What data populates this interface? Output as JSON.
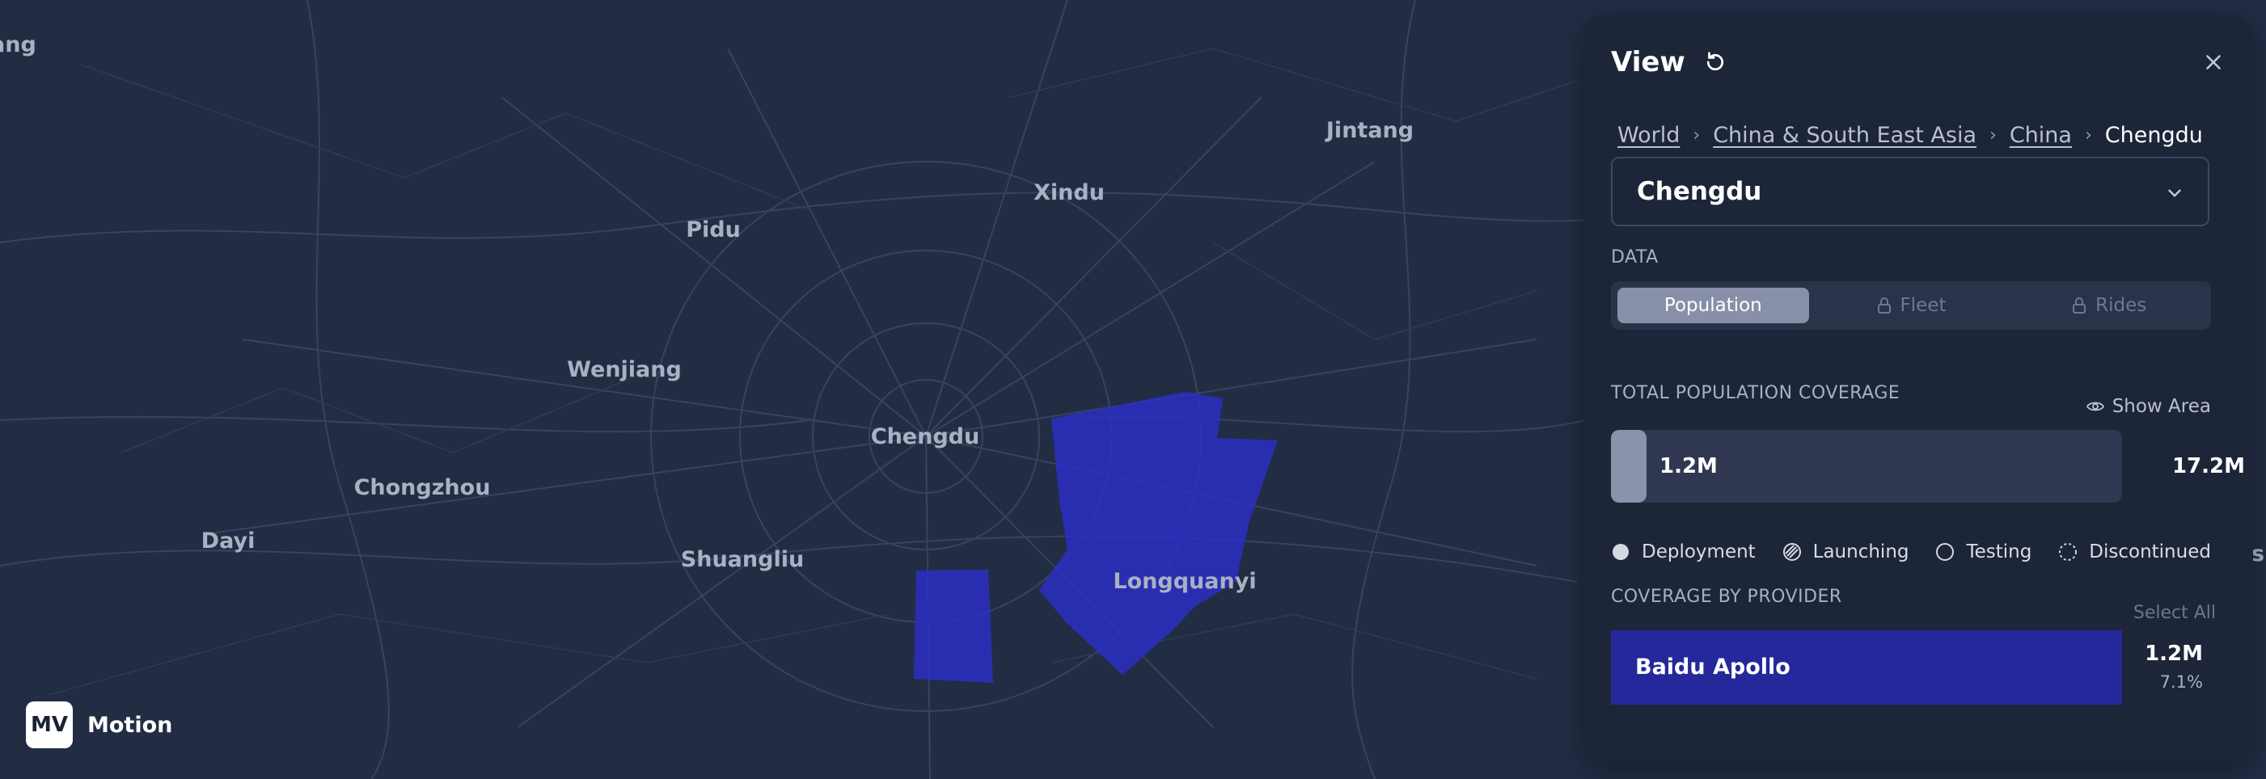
{
  "map": {
    "cities": [
      {
        "name": "ang",
        "id": "ang"
      },
      {
        "name": "Jintang",
        "id": "jintang"
      },
      {
        "name": "Xindu",
        "id": "xindu"
      },
      {
        "name": "Pidu",
        "id": "pidu"
      },
      {
        "name": "Wenjiang",
        "id": "wenjiang"
      },
      {
        "name": "Chengdu",
        "id": "chengdu"
      },
      {
        "name": "Chongzhou",
        "id": "chongzhou"
      },
      {
        "name": "Dayi",
        "id": "dayi"
      },
      {
        "name": "Shuangliu",
        "id": "shuangliu"
      },
      {
        "name": "Longquanyi",
        "id": "longquanyi"
      },
      {
        "name": "sh",
        "id": "sh"
      }
    ],
    "coverage_color": "#2a2fc4"
  },
  "brand": {
    "badge": "MV",
    "name": "Motion"
  },
  "panel": {
    "title": "View",
    "breadcrumb": {
      "world": "World",
      "region": "China & South East Asia",
      "country": "China",
      "city": "Chengdu"
    },
    "location_select": "Chengdu",
    "data_label": "DATA",
    "tabs": {
      "population": "Population",
      "fleet": "Fleet",
      "rides": "Rides"
    },
    "coverage": {
      "label": "TOTAL POPULATION COVERAGE",
      "show_area": "Show Area",
      "value": "1.2M",
      "total": "17.2M",
      "fraction": 0.07
    },
    "legend": {
      "deployment": "Deployment",
      "launching": "Launching",
      "testing": "Testing",
      "discontinued": "Discontinued"
    },
    "providers": {
      "label": "COVERAGE BY PROVIDER",
      "select_all": "Select All",
      "items": [
        {
          "name": "Baidu Apollo",
          "value": "1.2M",
          "percent": "7.1%"
        }
      ]
    }
  }
}
